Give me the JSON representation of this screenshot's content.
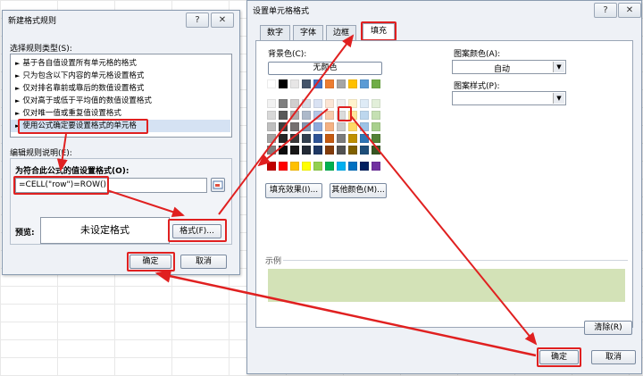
{
  "left_dialog": {
    "title": "新建格式规则",
    "help": "?",
    "close": "✕",
    "rule_type_label": "选择规则类型(S):",
    "rule_types": [
      "基于各自值设置所有单元格的格式",
      "只为包含以下内容的单元格设置格式",
      "仅对排名靠前或靠后的数值设置格式",
      "仅对高于或低于平均值的数值设置格式",
      "仅对唯一值或重复值设置格式",
      "使用公式确定要设置格式的单元格"
    ],
    "edit_label": "编辑规则说明(E):",
    "formula_label": "为符合此公式的值设置格式(O):",
    "formula": "=CELL(\"row\")=ROW()",
    "preview_label": "预览:",
    "preview_text": "未设定格式",
    "format_button": "格式(F)...",
    "ok_button": "确定",
    "cancel_button": "取消"
  },
  "right_dialog": {
    "title": "设置单元格格式",
    "help": "?",
    "close": "✕",
    "tabs": [
      "数字",
      "字体",
      "边框",
      "填充"
    ],
    "active_tab": "填充",
    "bg_color_label": "背景色(C):",
    "no_color_button": "无颜色",
    "pattern_color_label": "图案颜色(A):",
    "pattern_color_value": "自动",
    "pattern_style_label": "图案样式(P):",
    "pattern_style_value": "",
    "fill_effects_button": "填充效果(I)...",
    "more_colors_button": "其他颜色(M)...",
    "sample_label": "示例",
    "sample_color": "#d3e2b7",
    "clear_button": "清除(R)",
    "ok_button": "确定",
    "cancel_button": "取消",
    "palette_row1": [
      "#ffffff",
      "#000000",
      "#e7e6e6",
      "#44546a",
      "#4472c4",
      "#ed7d31",
      "#a5a5a5",
      "#ffc000",
      "#5b9bd5",
      "#70ad47"
    ],
    "palette_theme": [
      [
        "#f2f2f2",
        "#7f7f7f",
        "#d0cece",
        "#d6dce4",
        "#d9e2f3",
        "#fbe5d5",
        "#ededed",
        "#fff2cc",
        "#deebf6",
        "#e2efd9"
      ],
      [
        "#d8d8d8",
        "#595959",
        "#aeabab",
        "#adb9ca",
        "#b4c6e7",
        "#f7cbac",
        "#dbdbdb",
        "#fee599",
        "#bdd7ee",
        "#c5e0b3"
      ],
      [
        "#bfbfbf",
        "#3f3f3f",
        "#757070",
        "#8496b0",
        "#8eaadb",
        "#f4b183",
        "#c9c9c9",
        "#ffd965",
        "#9dc3e6",
        "#a8d08d"
      ],
      [
        "#a5a5a5",
        "#262626",
        "#3a3838",
        "#323f4f",
        "#2f5496",
        "#c55a11",
        "#7b7b7b",
        "#bf9000",
        "#2e75b5",
        "#538135"
      ],
      [
        "#7f7f7f",
        "#0c0c0c",
        "#171616",
        "#222a35",
        "#1f3864",
        "#833c0b",
        "#525252",
        "#7f6000",
        "#1e4e79",
        "#375623"
      ]
    ],
    "palette_standard": [
      "#c00000",
      "#ff0000",
      "#ffc000",
      "#ffff00",
      "#92d050",
      "#00b050",
      "#00b0f0",
      "#0070c0",
      "#002060",
      "#7030a0"
    ]
  },
  "colors": {
    "annotation": "#e02020",
    "dialog_bg": "#eef1f6"
  }
}
